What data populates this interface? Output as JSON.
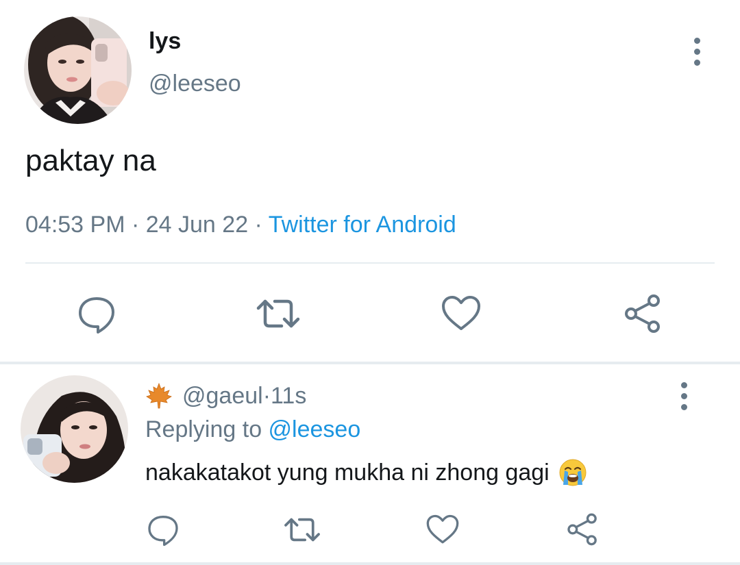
{
  "main_tweet": {
    "display_name": "lys",
    "handle": "@leeseo",
    "text": "paktay na",
    "time": "04:53 PM",
    "sep1": " · ",
    "date": "24 Jun 22",
    "sep2": " · ",
    "source": "Twitter for Android",
    "avatar_icon": "profile-photo",
    "actions": [
      "reply-icon",
      "retweet-icon",
      "like-icon",
      "share-icon"
    ]
  },
  "reply": {
    "name_emoji_icon": "maple-leaf-icon",
    "handle": "@gaeul",
    "sep": " · ",
    "age": "11s",
    "replying_prefix": "Replying to ",
    "replying_to": "@leeseo",
    "text": "nakakatakot yung mukha ni zhong gagi",
    "text_emoji_icon": "loudly-crying-face-icon",
    "actions": [
      "reply-icon",
      "retweet-icon",
      "like-icon",
      "share-icon"
    ]
  },
  "colors": {
    "primary_text": "#14171a",
    "secondary_text": "#657786",
    "link": "#1b95e0",
    "divider": "#e6ecf0"
  }
}
